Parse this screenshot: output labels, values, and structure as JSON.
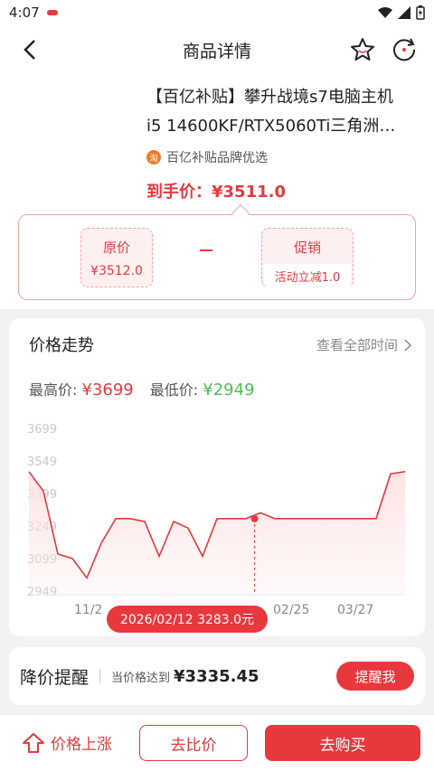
{
  "status": {
    "time": "4:07"
  },
  "nav": {
    "title": "商品详情"
  },
  "product": {
    "title_line1": "【百亿补贴】攀升战境s7电脑主机",
    "title_line2": "i5 14600KF/RTX5060Ti三角洲…",
    "brand": "百亿补贴品牌优选",
    "brand_icon_text": "淘",
    "final_price_label": "到手价：¥3511.0"
  },
  "calc": {
    "original_label": "原价",
    "original_value": "¥3512.0",
    "minus": "－",
    "promo_label": "促销",
    "promo_value": "活动立减1.0"
  },
  "trend": {
    "title": "价格走势",
    "view_all": "查看全部时间",
    "high_label": "最高价:",
    "high_value": "¥3699",
    "low_label": "最低价:",
    "low_value": "¥2949",
    "tooltip": "2026/02/12 3283.0元"
  },
  "chart_data": {
    "type": "area",
    "y_ticks": [
      "3699",
      "3549",
      "3399",
      "3249",
      "3099",
      "2949"
    ],
    "x_ticks": [
      "11/2",
      "02/25",
      "03/27"
    ],
    "ylim": [
      2949,
      3699
    ],
    "series": [
      {
        "values": [
          3500,
          3410,
          3120,
          3100,
          3010,
          3170,
          3283,
          3283,
          3270,
          3110,
          3270,
          3240,
          3110,
          3283,
          3283,
          3283,
          3310,
          3283,
          3283,
          3283,
          3283,
          3283,
          3283,
          3283,
          3283,
          3490,
          3500
        ]
      }
    ],
    "highlight": {
      "date": "2026/02/12",
      "value": 3283.0
    },
    "grid": false,
    "colors": {
      "line": "#e8383d",
      "fill": "#fde3e3"
    }
  },
  "alert": {
    "title": "降价提醒",
    "condition": "当价格达到",
    "amount": "¥3335.45",
    "button": "提醒我"
  },
  "bottom": {
    "rise": "价格上涨",
    "compare": "去比价",
    "buy": "去购买"
  }
}
